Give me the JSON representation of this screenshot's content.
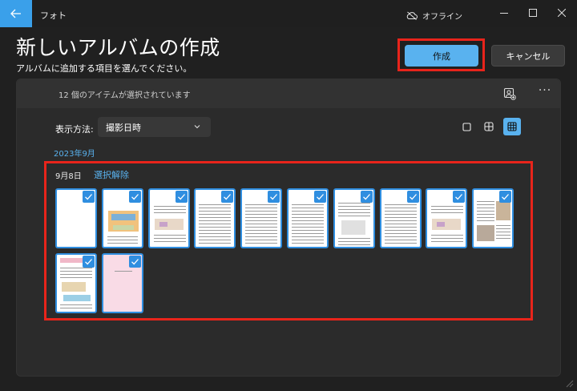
{
  "titlebar": {
    "app_name": "フォト",
    "status": "オフライン",
    "icons": [
      "back-arrow-icon",
      "cloud-offline-icon",
      "minimize-icon",
      "maximize-icon",
      "close-icon"
    ]
  },
  "header": {
    "title": "新しいアルバムの作成",
    "subtitle": "アルバムに追加する項目を選んでください。",
    "create_label": "作成",
    "cancel_label": "キャンセル"
  },
  "selection_bar": {
    "count_text": "12 個のアイテムが選択されています",
    "icons": [
      "people-photo-icon",
      "more-icon"
    ]
  },
  "toolbar": {
    "view_by_label": "表示方法:",
    "view_by_value": "撮影日時",
    "view_modes": [
      "single-view-icon",
      "medium-grid-icon",
      "small-grid-icon"
    ],
    "active_view": "small-grid-icon"
  },
  "group": {
    "month": "2023年9月",
    "date": "9月8日",
    "deselect_label": "選択解除",
    "thumbnails": [
      {
        "kind": "blank",
        "selected": true
      },
      {
        "kind": "illustration",
        "selected": true
      },
      {
        "kind": "illustration-doc",
        "selected": true
      },
      {
        "kind": "text-doc",
        "selected": true
      },
      {
        "kind": "text-doc",
        "selected": true
      },
      {
        "kind": "text-doc",
        "selected": true
      },
      {
        "kind": "text-doc-diagram",
        "selected": true
      },
      {
        "kind": "text-doc",
        "selected": true
      },
      {
        "kind": "illustration-doc",
        "selected": true
      },
      {
        "kind": "photo-doc",
        "selected": true
      },
      {
        "kind": "color-doc",
        "selected": true
      },
      {
        "kind": "pink-page",
        "selected": true
      }
    ]
  },
  "colors": {
    "accent": "#59b2ef",
    "highlight_outline": "#e8241b",
    "background": "#202020",
    "card": "#2b2b2b"
  }
}
